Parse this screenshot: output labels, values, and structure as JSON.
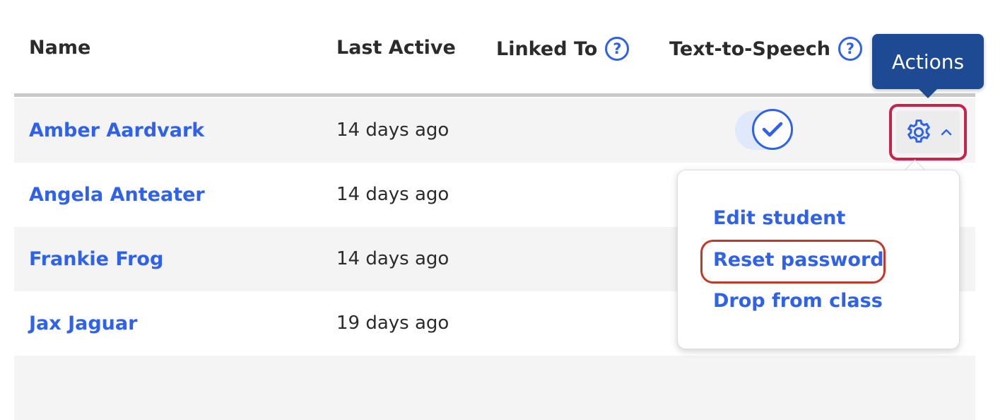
{
  "table": {
    "columns": {
      "name": "Name",
      "last_active": "Last Active",
      "linked_to": "Linked To",
      "text_to_speech": "Text-to-Speech"
    },
    "rows": [
      {
        "name": "Amber Aardvark",
        "last_active": "14 days ago",
        "text_to_speech": true
      },
      {
        "name": "Angela Anteater",
        "last_active": "14 days ago"
      },
      {
        "name": "Frankie Frog",
        "last_active": "14 days ago"
      },
      {
        "name": "Jax Jaguar",
        "last_active": "19 days ago"
      }
    ]
  },
  "tooltip": {
    "label": "Actions"
  },
  "actions_menu": {
    "items": [
      "Edit student",
      "Reset password",
      "Drop from class"
    ]
  },
  "icons": {
    "help": "question-circle-icon",
    "settings": "gear-icon",
    "chevron": "chevron-up-icon",
    "check": "check-icon"
  },
  "colors": {
    "link": "#2f62e8",
    "tooltip_bg": "#1e4a94",
    "focus_ring": "#c8234a",
    "highlight": "#c0392b"
  }
}
